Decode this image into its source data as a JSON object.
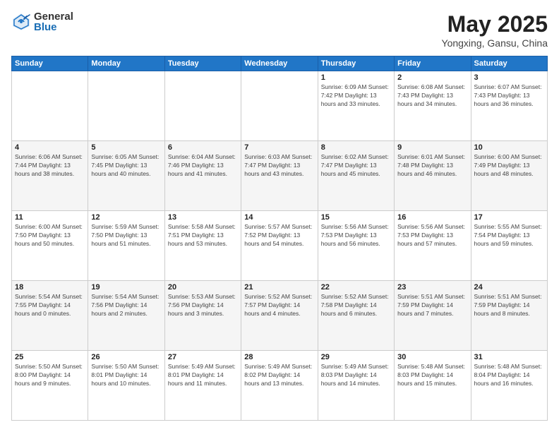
{
  "header": {
    "logo_general": "General",
    "logo_blue": "Blue",
    "month_title": "May 2025",
    "location": "Yongxing, Gansu, China"
  },
  "weekdays": [
    "Sunday",
    "Monday",
    "Tuesday",
    "Wednesday",
    "Thursday",
    "Friday",
    "Saturday"
  ],
  "weeks": [
    [
      {
        "day": "",
        "info": ""
      },
      {
        "day": "",
        "info": ""
      },
      {
        "day": "",
        "info": ""
      },
      {
        "day": "",
        "info": ""
      },
      {
        "day": "1",
        "info": "Sunrise: 6:09 AM\nSunset: 7:42 PM\nDaylight: 13 hours\nand 33 minutes."
      },
      {
        "day": "2",
        "info": "Sunrise: 6:08 AM\nSunset: 7:43 PM\nDaylight: 13 hours\nand 34 minutes."
      },
      {
        "day": "3",
        "info": "Sunrise: 6:07 AM\nSunset: 7:43 PM\nDaylight: 13 hours\nand 36 minutes."
      }
    ],
    [
      {
        "day": "4",
        "info": "Sunrise: 6:06 AM\nSunset: 7:44 PM\nDaylight: 13 hours\nand 38 minutes."
      },
      {
        "day": "5",
        "info": "Sunrise: 6:05 AM\nSunset: 7:45 PM\nDaylight: 13 hours\nand 40 minutes."
      },
      {
        "day": "6",
        "info": "Sunrise: 6:04 AM\nSunset: 7:46 PM\nDaylight: 13 hours\nand 41 minutes."
      },
      {
        "day": "7",
        "info": "Sunrise: 6:03 AM\nSunset: 7:47 PM\nDaylight: 13 hours\nand 43 minutes."
      },
      {
        "day": "8",
        "info": "Sunrise: 6:02 AM\nSunset: 7:47 PM\nDaylight: 13 hours\nand 45 minutes."
      },
      {
        "day": "9",
        "info": "Sunrise: 6:01 AM\nSunset: 7:48 PM\nDaylight: 13 hours\nand 46 minutes."
      },
      {
        "day": "10",
        "info": "Sunrise: 6:00 AM\nSunset: 7:49 PM\nDaylight: 13 hours\nand 48 minutes."
      }
    ],
    [
      {
        "day": "11",
        "info": "Sunrise: 6:00 AM\nSunset: 7:50 PM\nDaylight: 13 hours\nand 50 minutes."
      },
      {
        "day": "12",
        "info": "Sunrise: 5:59 AM\nSunset: 7:50 PM\nDaylight: 13 hours\nand 51 minutes."
      },
      {
        "day": "13",
        "info": "Sunrise: 5:58 AM\nSunset: 7:51 PM\nDaylight: 13 hours\nand 53 minutes."
      },
      {
        "day": "14",
        "info": "Sunrise: 5:57 AM\nSunset: 7:52 PM\nDaylight: 13 hours\nand 54 minutes."
      },
      {
        "day": "15",
        "info": "Sunrise: 5:56 AM\nSunset: 7:53 PM\nDaylight: 13 hours\nand 56 minutes."
      },
      {
        "day": "16",
        "info": "Sunrise: 5:56 AM\nSunset: 7:53 PM\nDaylight: 13 hours\nand 57 minutes."
      },
      {
        "day": "17",
        "info": "Sunrise: 5:55 AM\nSunset: 7:54 PM\nDaylight: 13 hours\nand 59 minutes."
      }
    ],
    [
      {
        "day": "18",
        "info": "Sunrise: 5:54 AM\nSunset: 7:55 PM\nDaylight: 14 hours\nand 0 minutes."
      },
      {
        "day": "19",
        "info": "Sunrise: 5:54 AM\nSunset: 7:56 PM\nDaylight: 14 hours\nand 2 minutes."
      },
      {
        "day": "20",
        "info": "Sunrise: 5:53 AM\nSunset: 7:56 PM\nDaylight: 14 hours\nand 3 minutes."
      },
      {
        "day": "21",
        "info": "Sunrise: 5:52 AM\nSunset: 7:57 PM\nDaylight: 14 hours\nand 4 minutes."
      },
      {
        "day": "22",
        "info": "Sunrise: 5:52 AM\nSunset: 7:58 PM\nDaylight: 14 hours\nand 6 minutes."
      },
      {
        "day": "23",
        "info": "Sunrise: 5:51 AM\nSunset: 7:59 PM\nDaylight: 14 hours\nand 7 minutes."
      },
      {
        "day": "24",
        "info": "Sunrise: 5:51 AM\nSunset: 7:59 PM\nDaylight: 14 hours\nand 8 minutes."
      }
    ],
    [
      {
        "day": "25",
        "info": "Sunrise: 5:50 AM\nSunset: 8:00 PM\nDaylight: 14 hours\nand 9 minutes."
      },
      {
        "day": "26",
        "info": "Sunrise: 5:50 AM\nSunset: 8:01 PM\nDaylight: 14 hours\nand 10 minutes."
      },
      {
        "day": "27",
        "info": "Sunrise: 5:49 AM\nSunset: 8:01 PM\nDaylight: 14 hours\nand 11 minutes."
      },
      {
        "day": "28",
        "info": "Sunrise: 5:49 AM\nSunset: 8:02 PM\nDaylight: 14 hours\nand 13 minutes."
      },
      {
        "day": "29",
        "info": "Sunrise: 5:49 AM\nSunset: 8:03 PM\nDaylight: 14 hours\nand 14 minutes."
      },
      {
        "day": "30",
        "info": "Sunrise: 5:48 AM\nSunset: 8:03 PM\nDaylight: 14 hours\nand 15 minutes."
      },
      {
        "day": "31",
        "info": "Sunrise: 5:48 AM\nSunset: 8:04 PM\nDaylight: 14 hours\nand 16 minutes."
      }
    ]
  ]
}
